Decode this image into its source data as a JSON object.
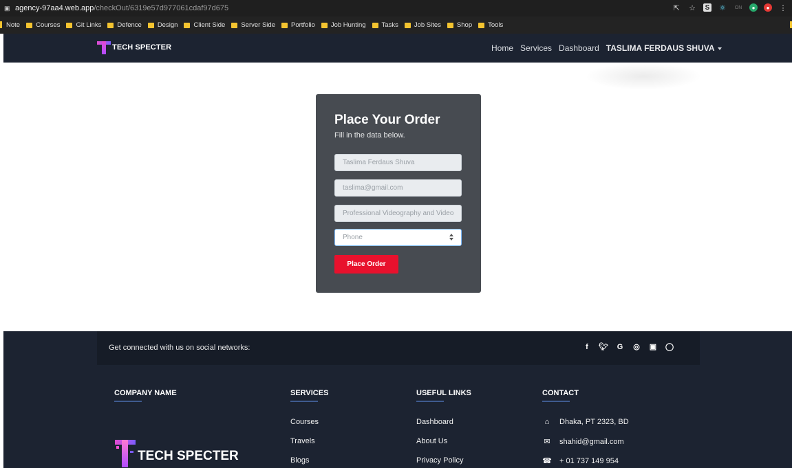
{
  "browser": {
    "url_host": "agency-97aa4.web.app",
    "url_path": "/checkOut/6319e57d977061cdaf97d675",
    "bookmarks": [
      "Note",
      "Courses",
      "Git Links",
      "Defence",
      "Design",
      "Client Side",
      "Server Side",
      "Portfolio",
      "Job Hunting",
      "Tasks",
      "Job Sites",
      "Shop",
      "Tools"
    ],
    "icons": [
      "share-icon",
      "star-icon",
      "extension-s-icon",
      "extension-atom-icon",
      "extension-on-icon",
      "extension-green-icon",
      "extension-red-icon",
      "menu-dots-icon"
    ]
  },
  "nav": {
    "brand": "TECH SPECTER",
    "links": [
      "Home",
      "Services",
      "Dashboard"
    ],
    "user": "TASLIMA FERDAUS SHUVA"
  },
  "order": {
    "title": "Place Your Order",
    "subtitle": "Fill in the data below.",
    "name_value": "Taslima Ferdaus Shuva",
    "email_value": "taslima@gmail.com",
    "service_value": "Professional Videography and Video",
    "phone_placeholder": "Phone",
    "button_label": "Place Order"
  },
  "footer": {
    "social_text": "Get connected with us on social networks:",
    "social_icons": [
      "facebook-icon",
      "twitter-icon",
      "google-icon",
      "instagram-icon",
      "linkedin-icon",
      "github-icon"
    ],
    "company_heading": "COMPANY NAME",
    "services_heading": "SERVICES",
    "services": [
      "Courses",
      "Travels",
      "Blogs"
    ],
    "useful_heading": "USEFUL LINKS",
    "useful": [
      "Dashboard",
      "About Us",
      "Privacy Policy"
    ],
    "contact_heading": "CONTACT",
    "contact": {
      "address": "Dhaka, PT 2323, BD",
      "email": "shahid@gmail.com",
      "phone": "+ 01 737 149 954"
    },
    "brand": "TECH SPECTER"
  },
  "colors": {
    "nav_bg": "#1c2331",
    "card_bg": "#474b51",
    "button_red": "#e8112d",
    "logo_gradient_start": "#e34bd1",
    "logo_gradient_end": "#7b5cff"
  }
}
